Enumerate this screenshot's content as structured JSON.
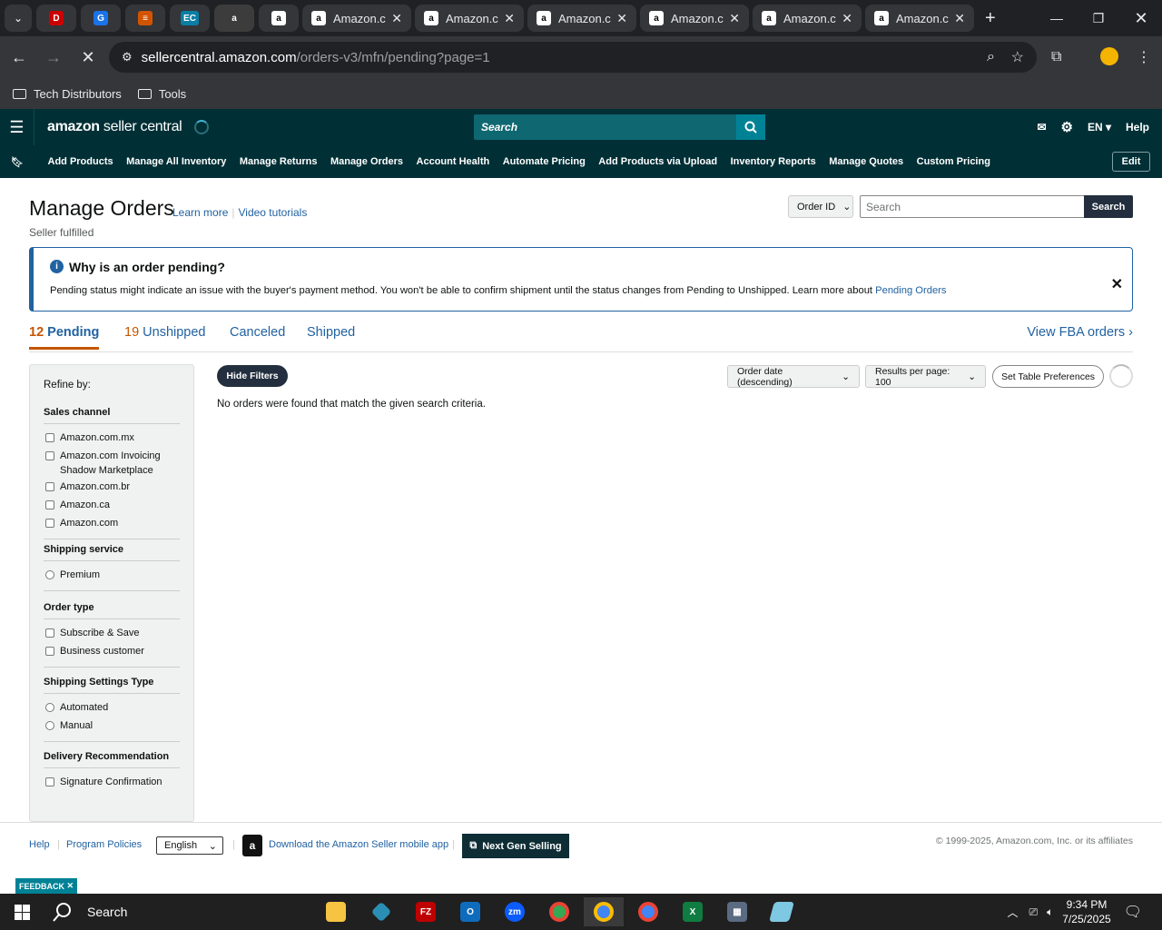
{
  "browser": {
    "tabs": [
      {
        "label": "Amazon.c",
        "fav_color": "#ff9900"
      },
      {
        "label": "Amazon.c",
        "fav_color": "#ff9900"
      },
      {
        "label": "Amazon.c",
        "fav_color": "#ff9900"
      },
      {
        "label": "Amazon.c",
        "fav_color": "#ff9900"
      },
      {
        "label": "Amazon.c",
        "fav_color": "#ff9900"
      },
      {
        "label": "Amazon.c",
        "fav_color": "#ff9900"
      }
    ],
    "pinned_tabs": [
      "dell-icon",
      "google-icon",
      "stack-icon",
      "ec-icon",
      "amazon-a-icon",
      "amazon-icon"
    ],
    "url_host": "sellercentral.amazon.com",
    "url_path": "/orders-v3/mfn/pending?page=1",
    "bookmarks": [
      "Tech Distributors",
      "Tools"
    ]
  },
  "header": {
    "logo_bold": "amazon",
    "logo_light": " seller central",
    "search_placeholder": "Search",
    "lang": "EN",
    "help": "Help",
    "edit": "Edit",
    "nav": [
      "Add Products",
      "Manage All Inventory",
      "Manage Returns",
      "Manage Orders",
      "Account Health",
      "Automate Pricing",
      "Add Products via Upload",
      "Inventory Reports",
      "Manage Quotes",
      "Custom Pricing"
    ]
  },
  "page": {
    "title": "Manage Orders",
    "learn_more": "Learn more",
    "video_tutorials": "Video tutorials",
    "subtitle": "Seller fulfilled",
    "search_by": "Order ID",
    "search_placeholder": "Search",
    "search_button": "Search"
  },
  "alert": {
    "heading": "Why is an order pending?",
    "body": "Pending status might indicate an issue with the buyer's payment method. You won't be able to confirm shipment until the status changes from Pending to Unshipped. Learn more about ",
    "link": "Pending Orders"
  },
  "tabs": {
    "pending_count": "12",
    "pending_label": "Pending",
    "unshipped_count": "19",
    "unshipped_label": "Unshipped",
    "canceled": "Canceled",
    "shipped": "Shipped",
    "fba": "View FBA orders"
  },
  "filters": {
    "refine": "Refine by:",
    "sales_channel": {
      "heading": "Sales channel",
      "options": [
        "Amazon.com.mx",
        "Amazon.com Invoicing Shadow Marketplace",
        "Amazon.com.br",
        "Amazon.ca",
        "Amazon.com"
      ]
    },
    "shipping_service": {
      "heading": "Shipping service",
      "options": [
        "Premium"
      ]
    },
    "order_type": {
      "heading": "Order type",
      "options": [
        "Subscribe & Save",
        "Business customer"
      ]
    },
    "shipping_settings": {
      "heading": "Shipping Settings Type",
      "options": [
        "Automated",
        "Manual"
      ]
    },
    "delivery": {
      "heading": "Delivery Recommendation",
      "options": [
        "Signature Confirmation"
      ]
    }
  },
  "results": {
    "hide_filters": "Hide Filters",
    "sort": "Order date (descending)",
    "per_page": "Results per page: 100",
    "prefs": "Set Table Preferences",
    "empty": "No orders were found that match the given search criteria."
  },
  "footer": {
    "help": "Help",
    "policies": "Program Policies",
    "language": "English",
    "app": "Download the Amazon Seller mobile app",
    "ngs": "Next Gen Selling",
    "copyright": "© 1999-2025, Amazon.com, Inc. or its affiliates",
    "feedback": "FEEDBACK"
  },
  "taskbar": {
    "search": "Search",
    "time": "9:34 PM",
    "date": "7/25/2025"
  }
}
